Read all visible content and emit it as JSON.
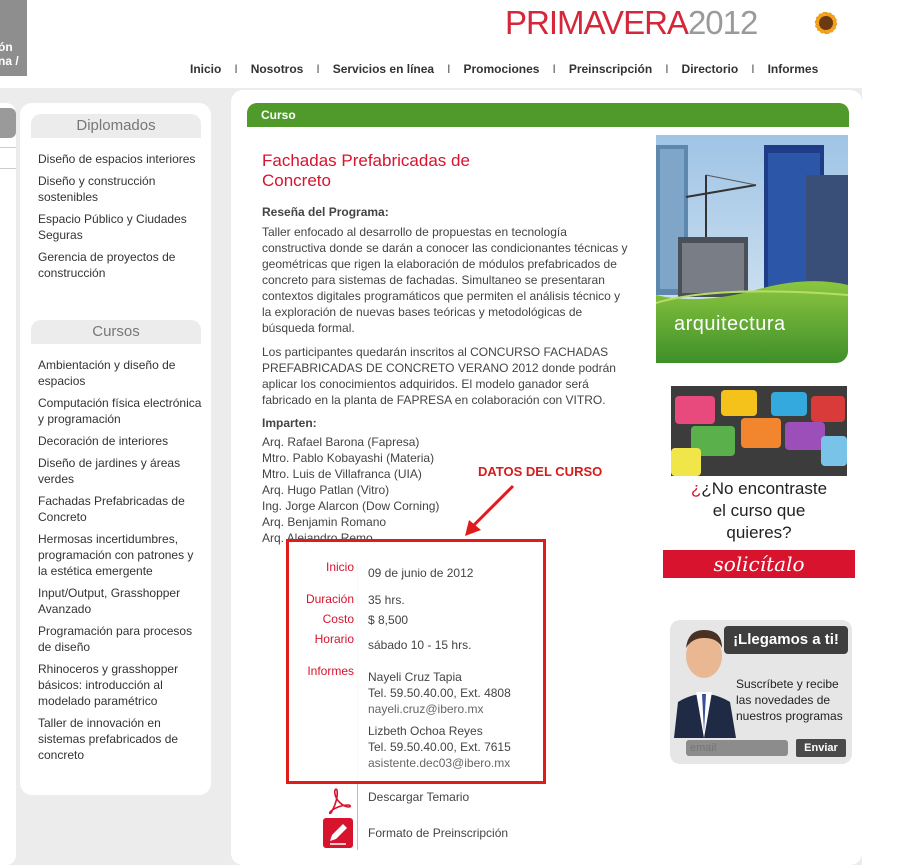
{
  "header": {
    "left_tab_line1": "ón",
    "left_tab_line2": "na /",
    "brand_main": "PRIMAVERA",
    "brand_year": "2012"
  },
  "nav": [
    "Inicio",
    "Nosotros",
    "Servicios en línea",
    "Promociones",
    "Preinscripción",
    "Directorio",
    "Informes"
  ],
  "sidebar": {
    "diplomados_title": "Diplomados",
    "diplomados": [
      "Diseño de espacios interiores",
      "Diseño y construcción sostenibles",
      "Espacio Público y Ciudades Seguras",
      "Gerencia de proyectos de construcción"
    ],
    "cursos_title": "Cursos",
    "cursos": [
      "Ambientación y diseño de espacios",
      "Computación física electrónica y programación",
      "Decoración de interiores",
      "Diseño de jardines y áreas verdes",
      "Fachadas Prefabricadas de Concreto",
      "Hermosas incertidumbres, programación con patrones y la estética emergente",
      "Input/Output, Grasshopper Avanzado",
      "Programación para procesos de diseño",
      "Rhinoceros y grasshopper básicos: introducción al modelado paramétrico",
      "Taller de innovación en sistemas prefabricados de concreto"
    ]
  },
  "main": {
    "bar_label": "Curso",
    "title": "Fachadas Prefabricadas de Concreto",
    "resena_heading": "Reseña del Programa:",
    "resena_p1": "Taller enfocado al desarrollo de propuestas en tecnología constructiva donde se darán a conocer las condicionantes técnicas y geométricas que rigen la elaboración de módulos prefabricados de concreto para sistemas de fachadas. Simultaneo se presentaran contextos digitales programáticos que permiten el análisis técnico y la exploración de nuevas bases teóricas y metodológicas de búsqueda formal.",
    "resena_p2": "Los participantes quedarán inscritos al CONCURSO FACHADAS PREFABRICADAS DE CONCRETO VERANO 2012 donde podrán aplicar los conocimientos adquiridos. El modelo ganador será fabricado en la planta de FAPRESA en colaboración con VITRO.",
    "imparten_heading": "Imparten:",
    "teachers": [
      "Arq. Rafael Barona (Fapresa)",
      "Mtro. Pablo Kobayashi (Materia)",
      "Mtro. Luis de Villafranca (UIA)",
      "Arq. Hugo Patlan (Vitro)",
      "Ing. Jorge Alarcon (Dow Corning)",
      "Arq. Benjamin Romano",
      "Arq. Alejandro Remo"
    ],
    "annotation": "DATOS DEL CURSO",
    "details": {
      "inicio_label": "Inicio",
      "inicio": "09 de junio de 2012",
      "duracion_label": "Duración",
      "duracion": "35 hrs.",
      "costo_label": "Costo",
      "costo": "$ 8,500",
      "horario_label": "Horario",
      "horario": "sábado 10 - 15 hrs.",
      "informes_label": "Informes",
      "contact1_name": "Nayeli Cruz Tapia",
      "contact1_tel": "Tel. 59.50.40.00, Ext. 4808",
      "contact1_email": "nayeli.cruz@ibero.mx",
      "contact2_name": "Lizbeth Ochoa Reyes",
      "contact2_tel": "Tel. 59.50.40.00, Ext. 7615",
      "contact2_email": "asistente.dec03@ibero.mx"
    },
    "download_label": "Descargar Temario",
    "form_label": "Formato de Preinscripción"
  },
  "right": {
    "arq_label": "arquitectura",
    "no_line1": "¿No encontraste",
    "no_line2": "el curso que",
    "no_line3": "quieres?",
    "solicitalo": "solicítalo",
    "llegamos": "¡Llegamos a ti!",
    "subscribe_l1": "Suscríbete y recibe",
    "subscribe_l2": "las novedades de",
    "subscribe_l3": "nuestros programas",
    "email_placeholder": "email",
    "send_label": "Enviar"
  },
  "colors": {
    "accent_red": "#d7132d",
    "green_bar": "#4f9a2b",
    "panel_bg": "#ececec"
  }
}
